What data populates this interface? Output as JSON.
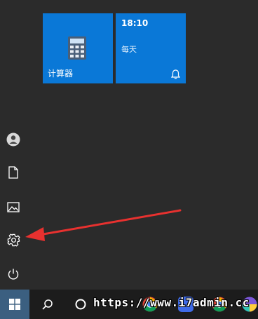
{
  "tiles": {
    "calculator": {
      "label": "计算器",
      "icon": "calculator-icon",
      "color": "#0a78d7"
    },
    "clock": {
      "time": "18:10",
      "subtitle": "每天",
      "icon": "bell-icon",
      "color": "#0a78d7"
    }
  },
  "left_rail": {
    "items": [
      {
        "icon": "user-icon"
      },
      {
        "icon": "document-icon"
      },
      {
        "icon": "pictures-icon"
      },
      {
        "icon": "settings-gear-icon"
      },
      {
        "icon": "power-icon"
      }
    ]
  },
  "annotation": {
    "arrow_color": "#e8312f",
    "points_to": "settings-gear-icon"
  },
  "taskbar": {
    "start_button_bg": "#3b5f80",
    "items": [
      {
        "icon": "windows-start-icon"
      },
      {
        "icon": "search-icon"
      },
      {
        "icon": "task-view-icon"
      },
      {
        "icon": "chrome-icon"
      },
      {
        "icon": "app-icon"
      },
      {
        "icon": "chrome-icon"
      },
      {
        "icon": "app-icon"
      }
    ]
  },
  "watermark": {
    "text": "https://www.i7admin.cc"
  }
}
